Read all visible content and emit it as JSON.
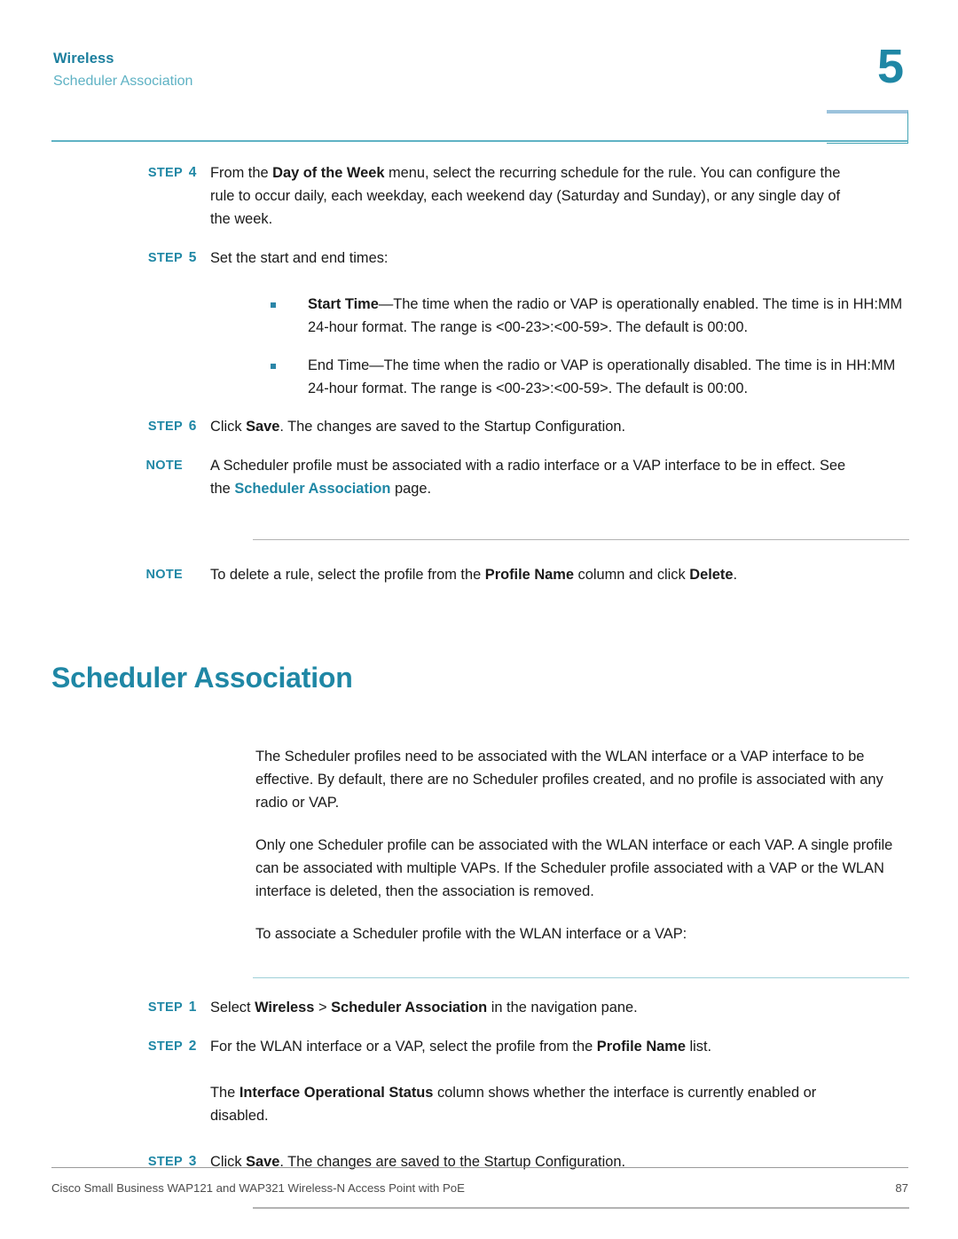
{
  "header": {
    "chapter_label": "Wireless",
    "section_label": "Scheduler Association",
    "chapter_number": "5"
  },
  "steps_top": [
    {
      "label": "STEP",
      "number": "4",
      "text_parts": [
        {
          "t": "From the ",
          "b": false
        },
        {
          "t": "Day of the Week",
          "b": true
        },
        {
          "t": " menu, select the recurring schedule for the rule. You can configure the rule to occur daily, each weekday, each weekend day (Saturday and Sunday), or any single day of the week.",
          "b": false
        }
      ]
    },
    {
      "label": "STEP",
      "number": "5",
      "text_parts": [
        {
          "t": "Set the start and end times:",
          "b": false
        }
      ]
    }
  ],
  "bullets": [
    {
      "marker": "square-bullet",
      "text_parts": [
        {
          "t": "Start Time",
          "b": true
        },
        {
          "t": "—The time when the radio or VAP is operationally enabled. The time is in HH:MM 24-hour format. The range is <00-23>:<00-59>. The default is 00:00.",
          "b": false
        }
      ]
    },
    {
      "marker": "square-bullet",
      "text_parts": [
        {
          "t": "End Time—The time when the radio or VAP is operationally disabled. The time is in HH:MM 24-hour format. The range is <00-23>:<00-59>. The default is 00:00.",
          "b": false
        }
      ]
    }
  ],
  "step6": {
    "label": "STEP",
    "number": "6",
    "text_parts": [
      {
        "t": "Click ",
        "b": false
      },
      {
        "t": "Save",
        "b": true
      },
      {
        "t": ". The changes are saved to the Startup Configuration.",
        "b": false
      }
    ]
  },
  "note1": {
    "label": "NOTE",
    "text_parts": [
      {
        "t": "A Scheduler profile must be associated with a radio interface or a VAP interface to be in effect. See the ",
        "b": false
      },
      {
        "t": "Scheduler Association",
        "b": false,
        "link": true
      },
      {
        "t": " page.",
        "b": false
      }
    ]
  },
  "note2": {
    "label": "NOTE",
    "text_parts": [
      {
        "t": "To delete a rule, select the profile from the ",
        "b": false
      },
      {
        "t": "Profile Name",
        "b": true
      },
      {
        "t": " column and click ",
        "b": false
      },
      {
        "t": "Delete",
        "b": true
      },
      {
        "t": ".",
        "b": false
      }
    ]
  },
  "heading": "Scheduler Association",
  "paragraphs": [
    "The Scheduler profiles need to be associated with the WLAN interface or a VAP interface to be effective. By default, there are no Scheduler profiles created, and no profile is associated with any radio or VAP.",
    "Only one Scheduler profile can be associated with the WLAN interface or each VAP. A single profile can be associated with multiple VAPs. If the Scheduler profile associated with a VAP or the WLAN interface is deleted, then the association is removed.",
    "To associate a Scheduler profile with the WLAN interface or a VAP:"
  ],
  "steps_bottom": [
    {
      "label": "STEP",
      "number": "1",
      "text_parts": [
        {
          "t": "Select ",
          "b": false
        },
        {
          "t": "Wireless",
          "b": true
        },
        {
          "t": " > ",
          "b": false
        },
        {
          "t": "Scheduler Association",
          "b": true
        },
        {
          "t": " in the navigation pane.",
          "b": false
        }
      ]
    },
    {
      "label": "STEP",
      "number": "2",
      "text_parts": [
        {
          "t": "For the WLAN interface or a VAP, select the profile from the ",
          "b": false
        },
        {
          "t": "Profile Name",
          "b": true
        },
        {
          "t": " list.",
          "b": false
        }
      ]
    }
  ],
  "step2_note": {
    "text_parts": [
      {
        "t": "The ",
        "b": false
      },
      {
        "t": "Interface Operational Status",
        "b": true
      },
      {
        "t": " column shows whether the interface is currently enabled or disabled.",
        "b": false
      }
    ]
  },
  "step3": {
    "label": "STEP",
    "number": "3",
    "text_parts": [
      {
        "t": "Click ",
        "b": false
      },
      {
        "t": "Save",
        "b": true
      },
      {
        "t": ". The changes are saved to the Startup Configuration.",
        "b": false
      }
    ]
  },
  "footer": {
    "left": "Cisco Small Business WAP121 and WAP321 Wireless-N Access Point with PoE",
    "page_number": "87"
  },
  "colors": {
    "accent_teal": "#1f87a5",
    "light_teal": "#5fb2c4",
    "rule_gray": "#b3b3b3",
    "rule_teal": "#9fd0d8"
  }
}
